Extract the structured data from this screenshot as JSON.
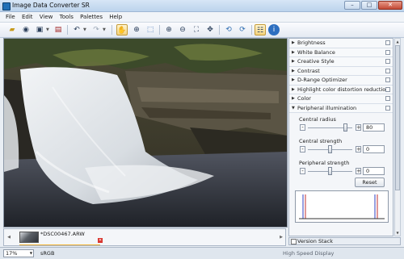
{
  "window": {
    "title": "Image Data Converter SR",
    "minimize": "–",
    "maximize": "□",
    "close": "✕"
  },
  "menu": [
    "File",
    "Edit",
    "View",
    "Tools",
    "Palettes",
    "Help"
  ],
  "panel": {
    "sections": [
      "Brightness",
      "White Balance",
      "Creative Style",
      "Contrast",
      "D-Range Optimizer",
      "Highlight color distortion reduction",
      "Color",
      "Peripheral illumination"
    ],
    "expanded_section": "Peripheral illumination",
    "sliders": [
      {
        "label": "Central radius",
        "value": "80",
        "fraction": 0.85
      },
      {
        "label": "Central strength",
        "value": "0",
        "fraction": 0.5
      },
      {
        "label": "Peripheral strength",
        "value": "0",
        "fraction": 0.5
      }
    ],
    "reset_label": "Reset",
    "version_stack_label": "Version Stack"
  },
  "filmstrip": {
    "filename": "*DSC00467.ARW",
    "remove_icon": "close-icon"
  },
  "status": {
    "zoom": "17%",
    "color_space": "sRGB",
    "display_mode": "High Speed Display"
  },
  "colors": {
    "accent": "#f2b233",
    "title_bar": "#c9dcf0",
    "panel": "#f4f6f9"
  }
}
